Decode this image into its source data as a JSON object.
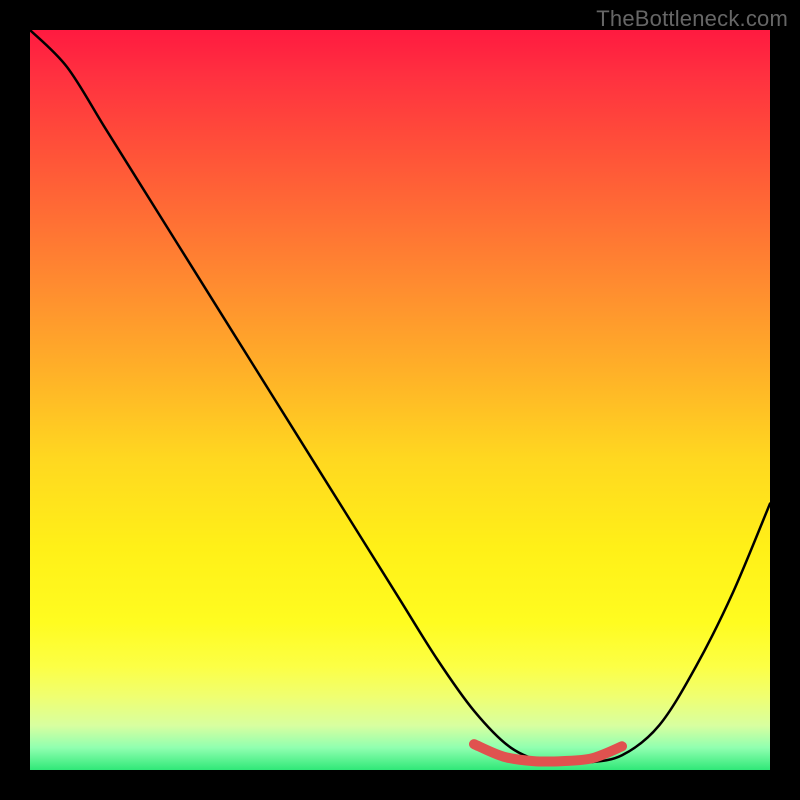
{
  "watermark": "TheBottleneck.com",
  "chart_data": {
    "type": "line",
    "title": "",
    "xlabel": "",
    "ylabel": "",
    "xlim": [
      0,
      100
    ],
    "ylim": [
      0,
      100
    ],
    "background_gradient": {
      "top": "#ff1a40",
      "mid": "#ffe020",
      "bottom": "#30e878",
      "meaning": "red = high bottleneck, green = optimal"
    },
    "series": [
      {
        "name": "bottleneck-curve",
        "color": "#000000",
        "x": [
          0,
          5,
          10,
          15,
          20,
          25,
          30,
          35,
          40,
          45,
          50,
          55,
          60,
          65,
          70,
          75,
          80,
          85,
          90,
          95,
          100
        ],
        "y": [
          100,
          95,
          87,
          79,
          71,
          63,
          55,
          47,
          39,
          31,
          23,
          15,
          8,
          3,
          1,
          1,
          2,
          6,
          14,
          24,
          36
        ]
      },
      {
        "name": "optimal-range-highlight",
        "color": "#e0524f",
        "x": [
          60,
          64,
          68,
          72,
          76,
          80
        ],
        "y": [
          3.5,
          1.8,
          1.2,
          1.2,
          1.6,
          3.2
        ]
      }
    ],
    "annotations": []
  }
}
